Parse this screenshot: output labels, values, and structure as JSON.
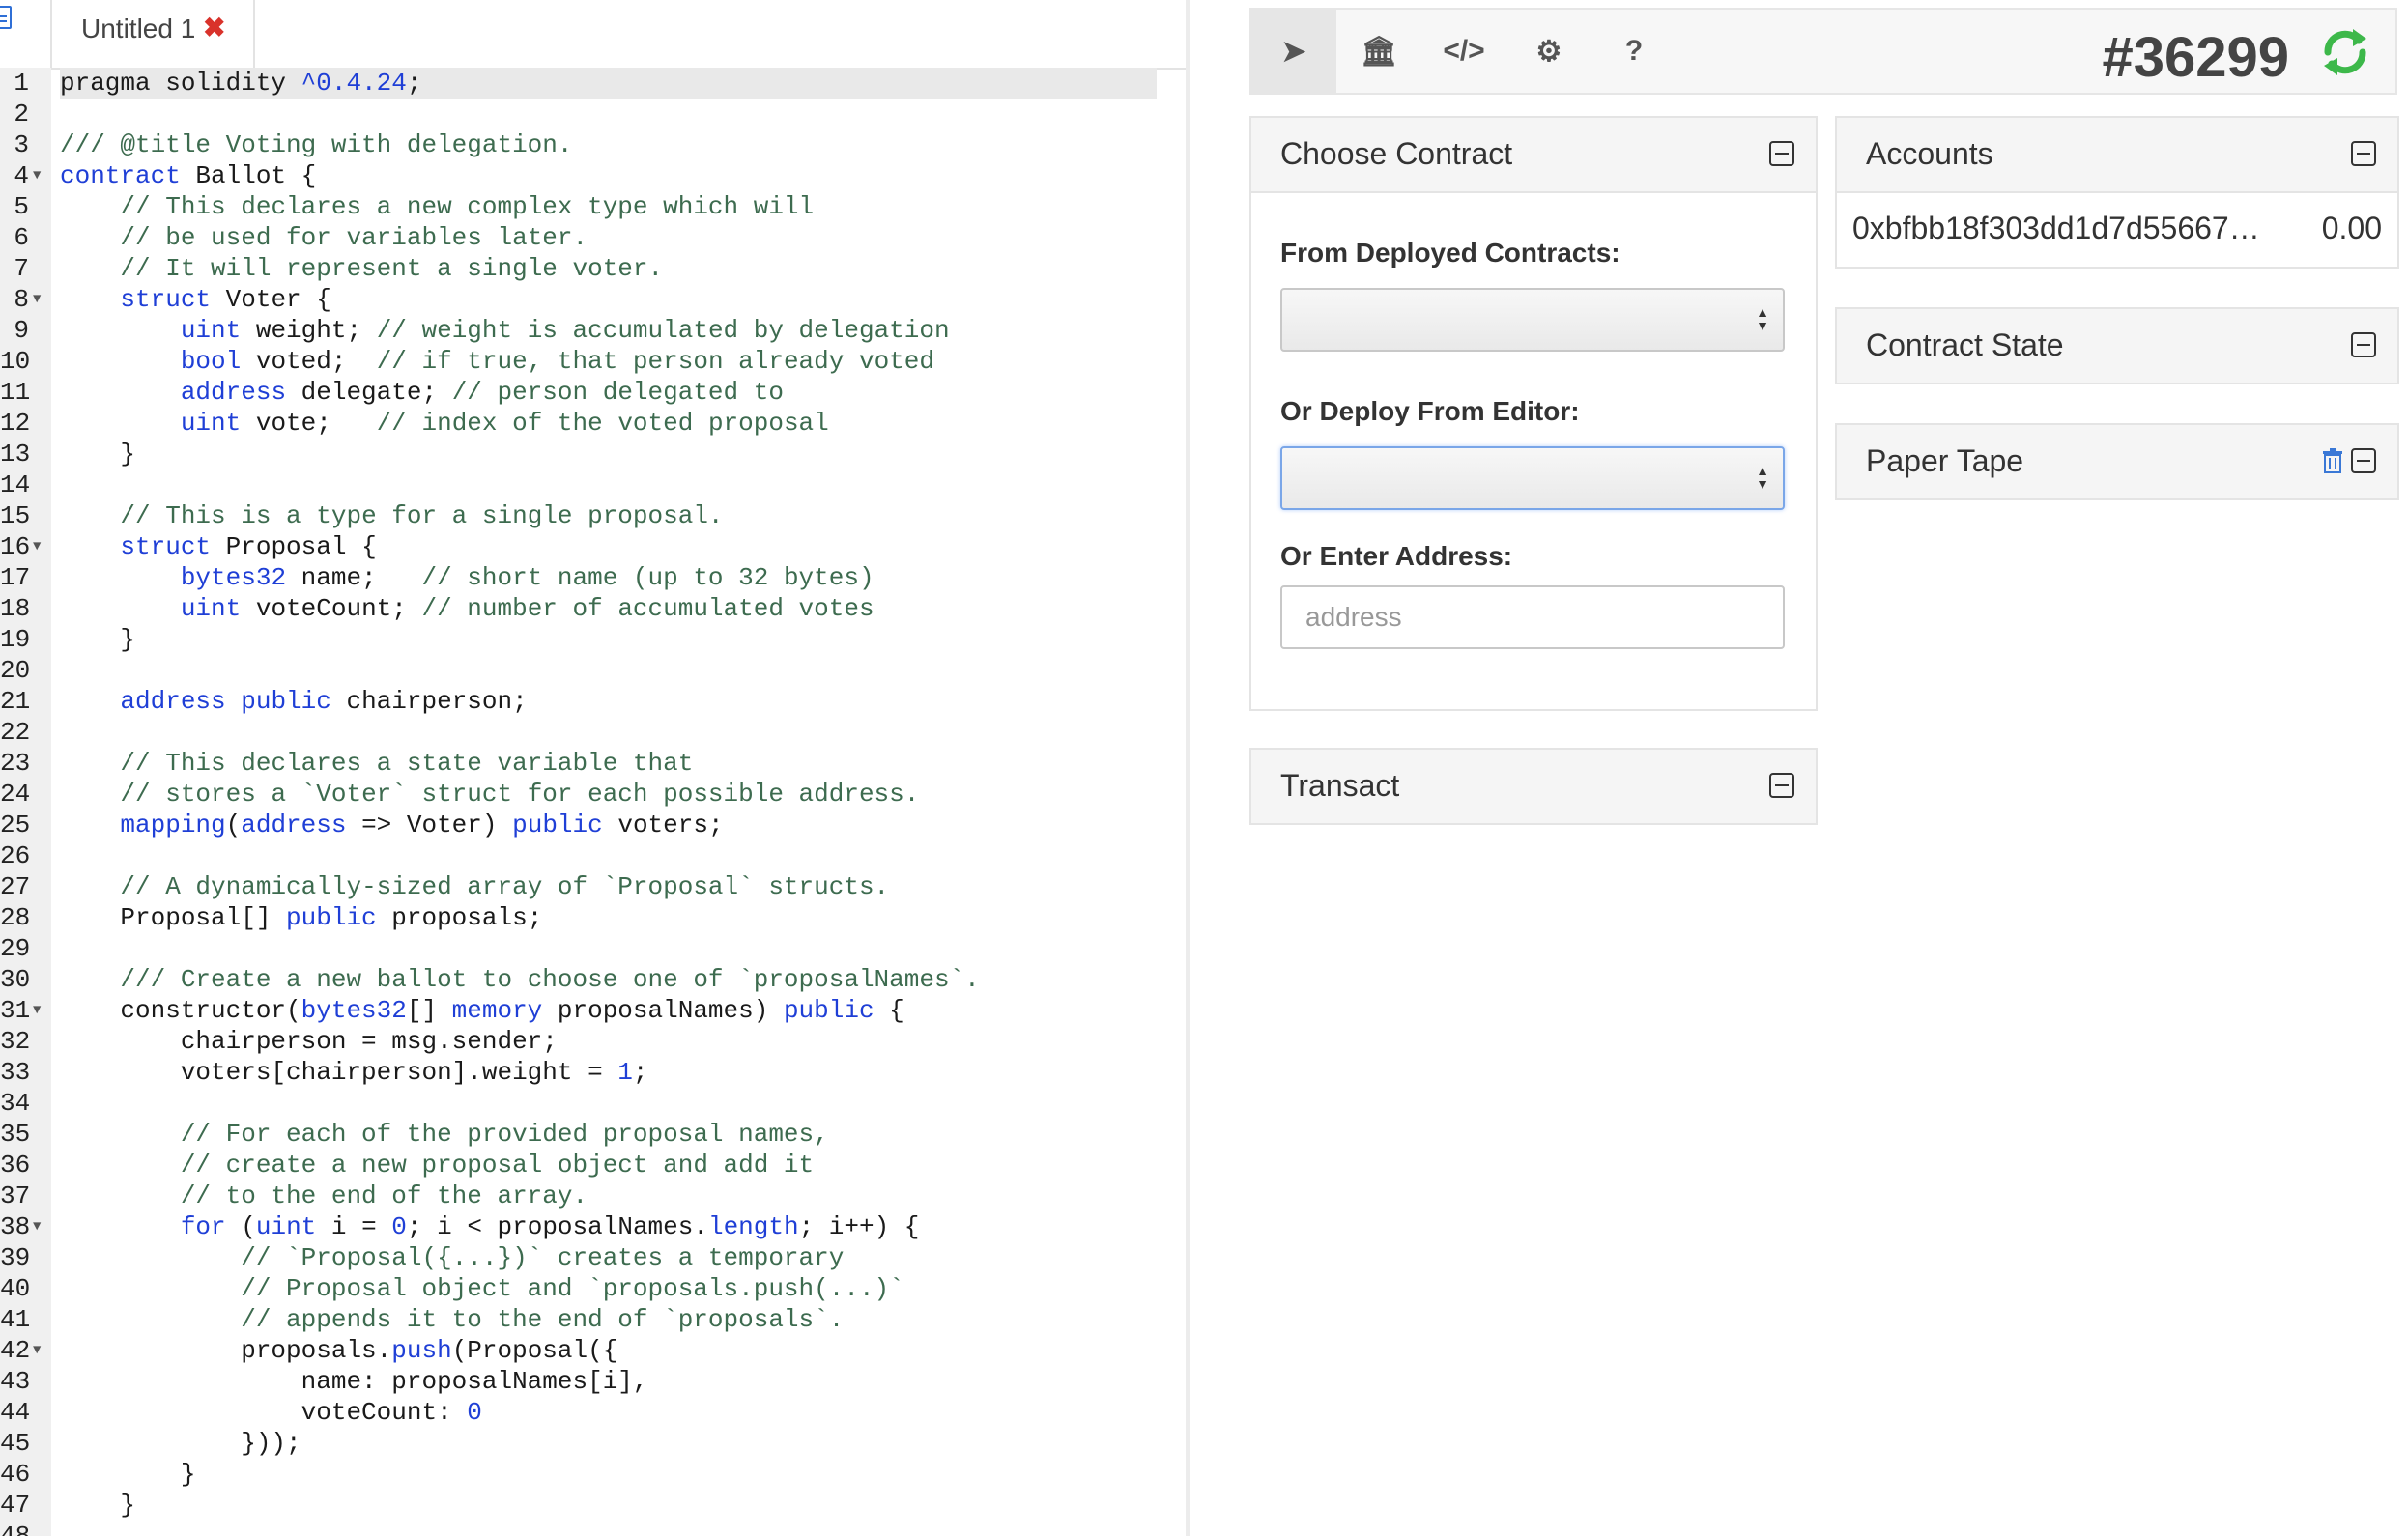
{
  "editor": {
    "tab_label": "Untitled 1",
    "tab_close": "✖",
    "lines": [
      [
        [
          "pragma solidity ",
          ""
        ],
        [
          "^0.4.24",
          "n"
        ],
        [
          ";",
          ""
        ]
      ],
      [],
      [
        [
          "/// @title Voting with delegation.",
          "c"
        ]
      ],
      [
        [
          "contract",
          "k"
        ],
        [
          " Ballot {",
          ""
        ]
      ],
      [
        [
          "    ",
          ""
        ],
        [
          "// This declares a new complex type which will",
          "c"
        ]
      ],
      [
        [
          "    ",
          ""
        ],
        [
          "// be used for variables later.",
          "c"
        ]
      ],
      [
        [
          "    ",
          ""
        ],
        [
          "// It will represent a single voter.",
          "c"
        ]
      ],
      [
        [
          "    ",
          ""
        ],
        [
          "struct",
          "k"
        ],
        [
          " Voter {",
          ""
        ]
      ],
      [
        [
          "        ",
          ""
        ],
        [
          "uint",
          "k"
        ],
        [
          " weight; ",
          ""
        ],
        [
          "// weight is accumulated by delegation",
          "c"
        ]
      ],
      [
        [
          "        ",
          ""
        ],
        [
          "bool",
          "k"
        ],
        [
          " voted;  ",
          ""
        ],
        [
          "// if true, that person already voted",
          "c"
        ]
      ],
      [
        [
          "        ",
          ""
        ],
        [
          "address",
          "k"
        ],
        [
          " delegate; ",
          ""
        ],
        [
          "// person delegated to",
          "c"
        ]
      ],
      [
        [
          "        ",
          ""
        ],
        [
          "uint",
          "k"
        ],
        [
          " vote;   ",
          ""
        ],
        [
          "// index of the voted proposal",
          "c"
        ]
      ],
      [
        [
          "    }",
          ""
        ]
      ],
      [],
      [
        [
          "    ",
          ""
        ],
        [
          "// This is a type for a single proposal.",
          "c"
        ]
      ],
      [
        [
          "    ",
          ""
        ],
        [
          "struct",
          "k"
        ],
        [
          " Proposal {",
          ""
        ]
      ],
      [
        [
          "        ",
          ""
        ],
        [
          "bytes32",
          "k"
        ],
        [
          " name;   ",
          ""
        ],
        [
          "// short name (up to 32 bytes)",
          "c"
        ]
      ],
      [
        [
          "        ",
          ""
        ],
        [
          "uint",
          "k"
        ],
        [
          " voteCount; ",
          ""
        ],
        [
          "// number of accumulated votes",
          "c"
        ]
      ],
      [
        [
          "    }",
          ""
        ]
      ],
      [],
      [
        [
          "    ",
          ""
        ],
        [
          "address",
          "k"
        ],
        [
          " ",
          ""
        ],
        [
          "public",
          "k"
        ],
        [
          " chairperson;",
          ""
        ]
      ],
      [],
      [
        [
          "    ",
          ""
        ],
        [
          "// This declares a state variable that",
          "c"
        ]
      ],
      [
        [
          "    ",
          ""
        ],
        [
          "// stores a `Voter` struct for each possible address.",
          "c"
        ]
      ],
      [
        [
          "    ",
          ""
        ],
        [
          "mapping",
          "k"
        ],
        [
          "(",
          ""
        ],
        [
          "address",
          "k"
        ],
        [
          " => Voter) ",
          ""
        ],
        [
          "public",
          "k"
        ],
        [
          " voters;",
          ""
        ]
      ],
      [],
      [
        [
          "    ",
          ""
        ],
        [
          "// A dynamically-sized array of `Proposal` structs.",
          "c"
        ]
      ],
      [
        [
          "    Proposal[] ",
          ""
        ],
        [
          "public",
          "k"
        ],
        [
          " proposals;",
          ""
        ]
      ],
      [],
      [
        [
          "    ",
          ""
        ],
        [
          "/// Create a new ballot to choose one of `proposalNames`.",
          "c"
        ]
      ],
      [
        [
          "    constructor(",
          ""
        ],
        [
          "bytes32",
          "k"
        ],
        [
          "[] ",
          ""
        ],
        [
          "memory",
          "k"
        ],
        [
          " proposalNames) ",
          ""
        ],
        [
          "public",
          "k"
        ],
        [
          " {",
          ""
        ]
      ],
      [
        [
          "        chairperson = msg.sender;",
          ""
        ]
      ],
      [
        [
          "        voters[chairperson].weight = ",
          ""
        ],
        [
          "1",
          "n"
        ],
        [
          ";",
          ""
        ]
      ],
      [],
      [
        [
          "        ",
          ""
        ],
        [
          "// For each of the provided proposal names,",
          "c"
        ]
      ],
      [
        [
          "        ",
          ""
        ],
        [
          "// create a new proposal object and add it",
          "c"
        ]
      ],
      [
        [
          "        ",
          ""
        ],
        [
          "// to the end of the array.",
          "c"
        ]
      ],
      [
        [
          "        ",
          ""
        ],
        [
          "for",
          "k"
        ],
        [
          " (",
          ""
        ],
        [
          "uint",
          "k"
        ],
        [
          " i = ",
          ""
        ],
        [
          "0",
          "n"
        ],
        [
          "; i < proposalNames.",
          ""
        ],
        [
          "length",
          "k"
        ],
        [
          "; i++) {",
          ""
        ]
      ],
      [
        [
          "            ",
          ""
        ],
        [
          "// `Proposal({...})` creates a temporary",
          "c"
        ]
      ],
      [
        [
          "            ",
          ""
        ],
        [
          "// Proposal object and `proposals.push(...)`",
          "c"
        ]
      ],
      [
        [
          "            ",
          ""
        ],
        [
          "// appends it to the end of `proposals`.",
          "c"
        ]
      ],
      [
        [
          "            proposals.",
          ""
        ],
        [
          "push",
          "k"
        ],
        [
          "(Proposal({",
          ""
        ]
      ],
      [
        [
          "                name: proposalNames[i],",
          ""
        ]
      ],
      [
        [
          "                voteCount: ",
          ""
        ],
        [
          "0",
          "n"
        ]
      ],
      [
        [
          "            }));",
          ""
        ]
      ],
      [
        [
          "        }",
          ""
        ]
      ],
      [
        [
          "    }",
          ""
        ]
      ],
      []
    ],
    "fold_lines": [
      4,
      8,
      16,
      31,
      38,
      42
    ]
  },
  "toolbar": {
    "tabs": [
      {
        "name": "send-icon",
        "glyph": "➤"
      },
      {
        "name": "bank-icon",
        "glyph": "🏛"
      },
      {
        "name": "code-icon",
        "glyph": "</>"
      },
      {
        "name": "gear-icon",
        "glyph": "⚙"
      },
      {
        "name": "help-icon",
        "glyph": "?"
      }
    ],
    "active_tab": 0,
    "block_number": "#36299",
    "refresh_color": "#3db84a"
  },
  "choose_contract": {
    "title": "Choose Contract",
    "from_deployed_label": "From Deployed Contracts:",
    "deploy_from_editor_label": "Or Deploy From Editor:",
    "enter_address_label": "Or Enter Address:",
    "address_placeholder": "address",
    "address_value": ""
  },
  "transact": {
    "title": "Transact"
  },
  "accounts": {
    "title": "Accounts",
    "items": [
      {
        "address": "0xbfbb18f303dd1d7d55667…",
        "balance": "0.00"
      }
    ]
  },
  "contract_state": {
    "title": "Contract State"
  },
  "paper_tape": {
    "title": "Paper Tape"
  }
}
